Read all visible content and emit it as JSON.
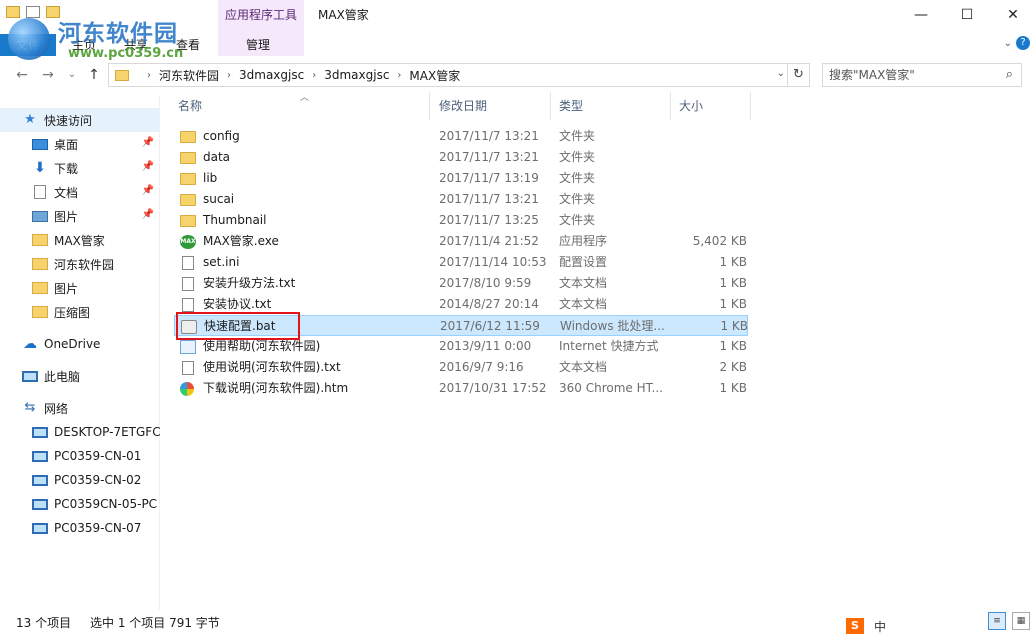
{
  "window": {
    "title": "MAX管家",
    "context_tab_group": "应用程序工具",
    "controls": {
      "minimize": "—",
      "maximize": "☐",
      "close": "✕"
    }
  },
  "ribbon": {
    "tabs": [
      {
        "label": "文件"
      },
      {
        "label": "主页"
      },
      {
        "label": "共享"
      },
      {
        "label": "查看"
      },
      {
        "label": "管理"
      }
    ]
  },
  "watermark": {
    "title": "河东软件园",
    "url": "www.pc0359.cn"
  },
  "address": {
    "breadcrumbs": [
      "河东软件园",
      "3dmaxgjsc",
      "3dmaxgjsc",
      "MAX管家"
    ],
    "search_placeholder": "搜索\"MAX管家\""
  },
  "nav": {
    "items": [
      {
        "label": "快速访问",
        "icon": "star-icon",
        "pinned": false,
        "selected": true
      },
      {
        "label": "桌面",
        "icon": "desktop-icon",
        "pinned": true,
        "selected": false
      },
      {
        "label": "下载",
        "icon": "download-icon",
        "pinned": true,
        "selected": false
      },
      {
        "label": "文档",
        "icon": "document-icon",
        "pinned": true,
        "selected": false
      },
      {
        "label": "图片",
        "icon": "pictures-icon",
        "pinned": true,
        "selected": false
      },
      {
        "label": "MAX管家",
        "icon": "folder-icon",
        "pinned": false,
        "selected": false
      },
      {
        "label": "河东软件园",
        "icon": "folder-icon",
        "pinned": false,
        "selected": false
      },
      {
        "label": "图片",
        "icon": "folder-icon",
        "pinned": false,
        "selected": false
      },
      {
        "label": "压缩图",
        "icon": "folder-icon",
        "pinned": false,
        "selected": false
      },
      {
        "label": "OneDrive",
        "icon": "onedrive-icon",
        "pinned": false,
        "selected": false
      },
      {
        "label": "此电脑",
        "icon": "this-pc-icon",
        "pinned": false,
        "selected": false
      },
      {
        "label": "网络",
        "icon": "network-icon",
        "pinned": false,
        "selected": false
      },
      {
        "label": "DESKTOP-7ETGFC",
        "icon": "computer-icon",
        "pinned": false,
        "selected": false
      },
      {
        "label": "PC0359-CN-01",
        "icon": "computer-icon",
        "pinned": false,
        "selected": false
      },
      {
        "label": "PC0359-CN-02",
        "icon": "computer-icon",
        "pinned": false,
        "selected": false
      },
      {
        "label": "PC0359CN-05-PC",
        "icon": "computer-icon",
        "pinned": false,
        "selected": false
      },
      {
        "label": "PC0359-CN-07",
        "icon": "computer-icon",
        "pinned": false,
        "selected": false
      }
    ]
  },
  "columns": {
    "name": "名称",
    "date": "修改日期",
    "type": "类型",
    "size": "大小"
  },
  "files": [
    {
      "name": "config",
      "date": "2017/11/7 13:21",
      "type": "文件夹",
      "size": "",
      "icon": "folder",
      "selected": false
    },
    {
      "name": "data",
      "date": "2017/11/7 13:21",
      "type": "文件夹",
      "size": "",
      "icon": "folder",
      "selected": false
    },
    {
      "name": "lib",
      "date": "2017/11/7 13:19",
      "type": "文件夹",
      "size": "",
      "icon": "folder",
      "selected": false
    },
    {
      "name": "sucai",
      "date": "2017/11/7 13:21",
      "type": "文件夹",
      "size": "",
      "icon": "folder",
      "selected": false
    },
    {
      "name": "Thumbnail",
      "date": "2017/11/7 13:25",
      "type": "文件夹",
      "size": "",
      "icon": "folder",
      "selected": false
    },
    {
      "name": "MAX管家.exe",
      "date": "2017/11/4 21:52",
      "type": "应用程序",
      "size": "5,402 KB",
      "icon": "exe",
      "icon_text": "MAX",
      "selected": false
    },
    {
      "name": "set.ini",
      "date": "2017/11/14 10:53",
      "type": "配置设置",
      "size": "1 KB",
      "icon": "ini",
      "selected": false
    },
    {
      "name": "安装升级方法.txt",
      "date": "2017/8/10 9:59",
      "type": "文本文档",
      "size": "1 KB",
      "icon": "txt",
      "selected": false
    },
    {
      "name": "安装协议.txt",
      "date": "2014/8/27 20:14",
      "type": "文本文档",
      "size": "1 KB",
      "icon": "txt",
      "selected": false
    },
    {
      "name": "快速配置.bat",
      "date": "2017/6/12 11:59",
      "type": "Windows 批处理...",
      "size": "1 KB",
      "icon": "bat",
      "selected": true
    },
    {
      "name": "使用帮助(河东软件园)",
      "date": "2013/9/11 0:00",
      "type": "Internet 快捷方式",
      "size": "1 KB",
      "icon": "url",
      "selected": false
    },
    {
      "name": "使用说明(河东软件园).txt",
      "date": "2016/9/7 9:16",
      "type": "文本文档",
      "size": "2 KB",
      "icon": "txt",
      "selected": false
    },
    {
      "name": "下载说明(河东软件园).htm",
      "date": "2017/10/31 17:52",
      "type": "360 Chrome HT...",
      "size": "1 KB",
      "icon": "htm",
      "selected": false
    }
  ],
  "status": {
    "item_count": "13 个项目",
    "selection": "选中 1 个项目  791 字节"
  },
  "tray": {
    "ime": "S",
    "lang": "中"
  },
  "colors": {
    "accent": "#1979ca",
    "selection": "#cce8ff",
    "highlight_box": "#e0141a"
  }
}
